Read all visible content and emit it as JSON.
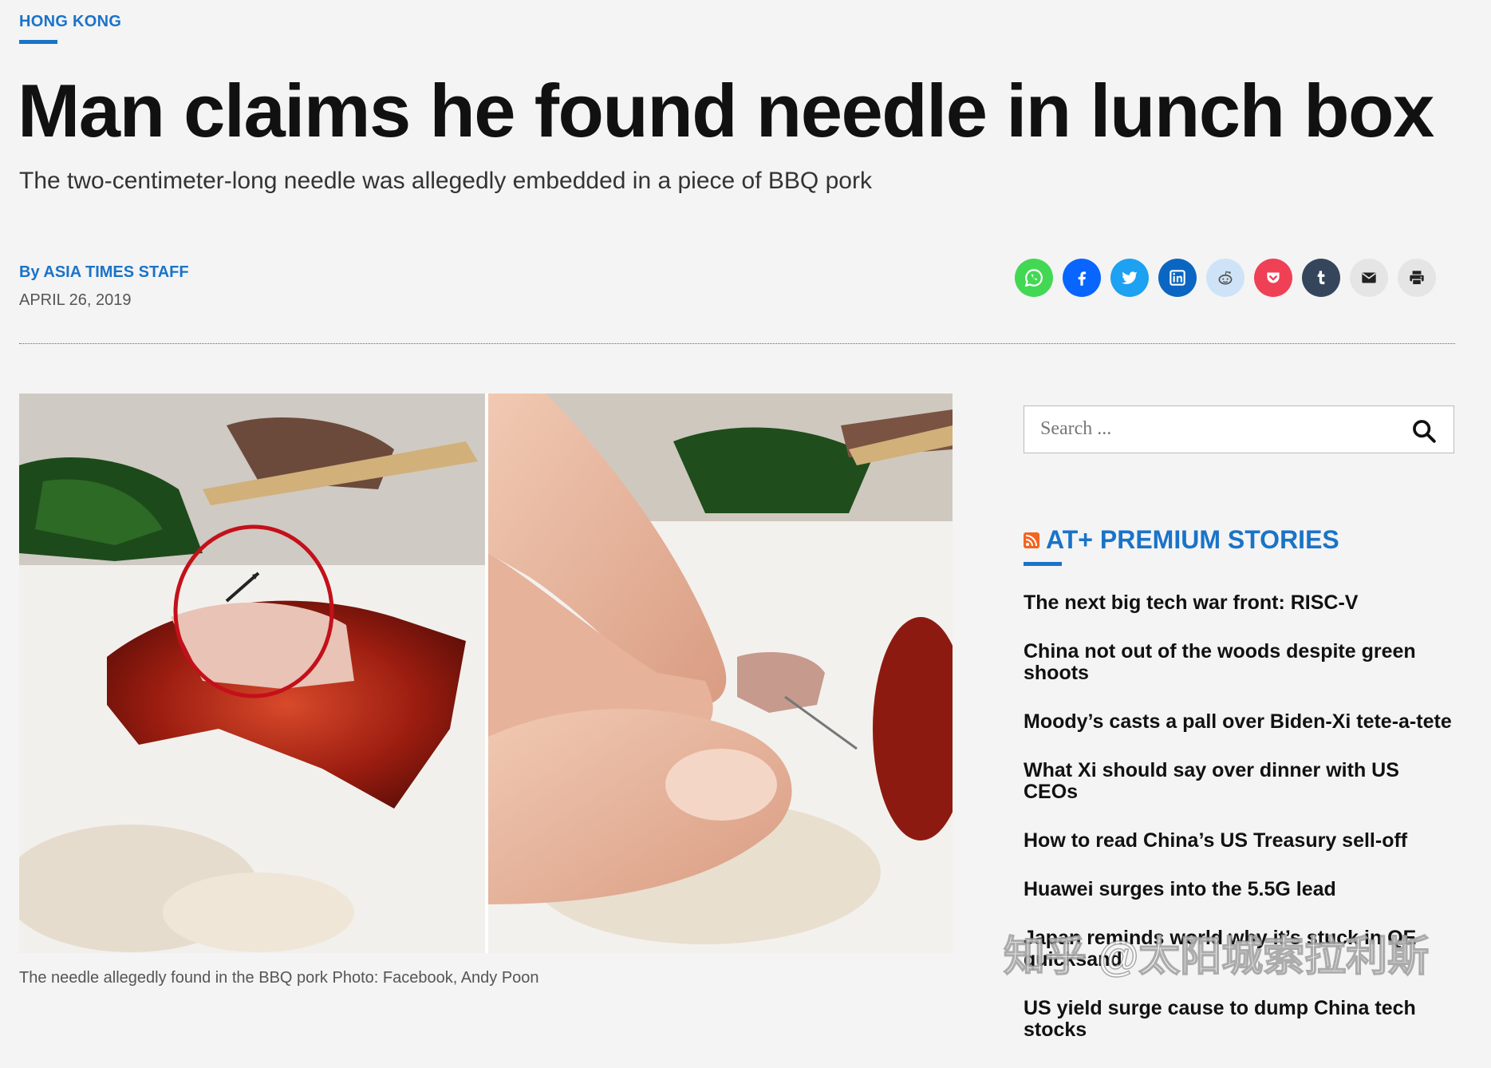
{
  "article": {
    "category": "HONG KONG",
    "headline": "Man claims he found needle in lunch box",
    "subhead": "The two-centimeter-long needle was allegedly embedded in a piece of BBQ pork",
    "byline_prefix": "By ",
    "author": "ASIA TIMES STAFF",
    "date": "APRIL 26, 2019",
    "caption": "The needle allegedly found in the BBQ pork Photo: Facebook, Andy Poon"
  },
  "share": [
    {
      "name": "whatsapp-share-button",
      "icon": "whatsapp-icon",
      "color": "#43d854"
    },
    {
      "name": "facebook-share-button",
      "icon": "facebook-icon",
      "color": "#0866ff"
    },
    {
      "name": "twitter-share-button",
      "icon": "twitter-icon",
      "color": "#1da1f2"
    },
    {
      "name": "linkedin-share-button",
      "icon": "linkedin-icon",
      "color": "#0a66c2"
    },
    {
      "name": "reddit-share-button",
      "icon": "reddit-icon",
      "color": "#cee3f8"
    },
    {
      "name": "pocket-share-button",
      "icon": "pocket-icon",
      "color": "#ef4056"
    },
    {
      "name": "tumblr-share-button",
      "icon": "tumblr-icon",
      "color": "#35465c"
    },
    {
      "name": "email-share-button",
      "icon": "email-icon",
      "color": "#e5e5e5"
    },
    {
      "name": "print-share-button",
      "icon": "print-icon",
      "color": "#e5e5e5"
    }
  ],
  "sidebar": {
    "search_placeholder": "Search ...",
    "premium_title": "AT+ PREMIUM STORIES",
    "stories": [
      "The next big tech war front: RISC-V",
      "China not out of the woods despite green shoots",
      "Moody’s casts a pall over Biden-Xi tete-a-tete",
      "What Xi should say over dinner with US CEOs",
      "How to read China’s US Treasury sell-off",
      "Huawei surges into the 5.5G lead",
      "Japan reminds world why it’s stuck in QE quicksand",
      "US yield surge cause to dump China tech stocks"
    ]
  },
  "watermark": "知乎 @太阳城索拉利斯",
  "colors": {
    "accent": "#1a73c8",
    "background": "#f4f4f4"
  }
}
